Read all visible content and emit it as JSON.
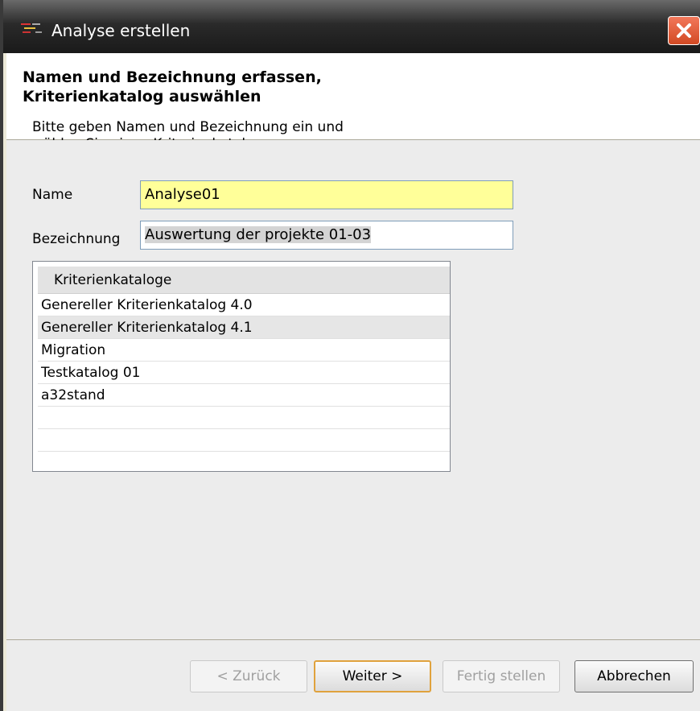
{
  "window": {
    "title": "Analyse erstellen"
  },
  "header": {
    "title_line1": "Namen und Bezeichnung erfassen,",
    "title_line2": "Kriterienkatalog auswählen",
    "desc_line1": "Bitte geben Namen und Bezeichnung ein und",
    "desc_line2": "wählen Sie einen Kriterienkatalog aus."
  },
  "form": {
    "name_label": "Name",
    "name_value": "Analyse01",
    "bezeichnung_label": "Bezeichnung",
    "bezeichnung_value": "Auswertung der projekte 01-03"
  },
  "catalogs": {
    "header": "Kriterienkataloge",
    "items": [
      {
        "label": "Genereller Kriterienkatalog 4.0",
        "selected": false
      },
      {
        "label": "Genereller Kriterienkatalog 4.1",
        "selected": true
      },
      {
        "label": "Migration",
        "selected": false
      },
      {
        "label": "Testkatalog 01",
        "selected": false
      },
      {
        "label": "a32stand",
        "selected": false
      }
    ]
  },
  "buttons": {
    "back": "< Zurück",
    "next": "Weiter >",
    "finish": "Fertig stellen",
    "cancel": "Abbrechen"
  },
  "colors": {
    "name_field_bg": "#ffff99",
    "selected_row_bg": "#e6e6e6"
  }
}
